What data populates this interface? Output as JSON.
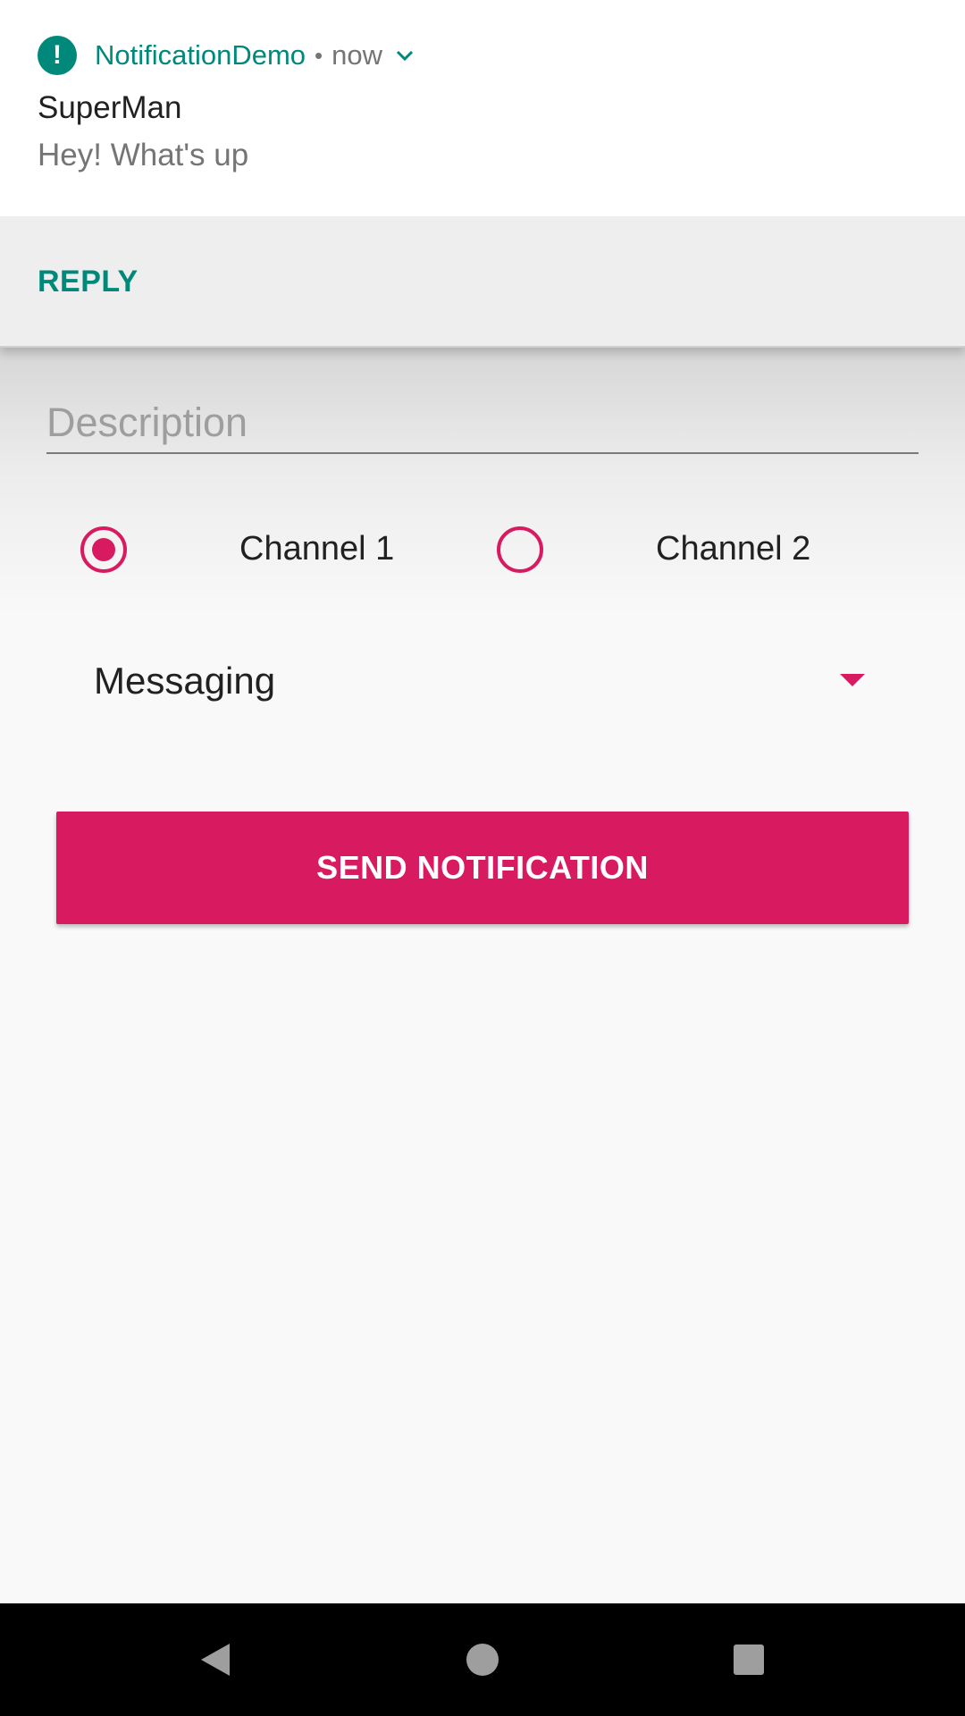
{
  "notification": {
    "app_icon": "alert-icon",
    "app_icon_glyph": "!",
    "app_name": "NotificationDemo",
    "separator": "•",
    "time": "now",
    "expand_icon": "chevron-down-icon",
    "title": "SuperMan",
    "text": "Hey! What's up",
    "action_label": "REPLY"
  },
  "form": {
    "description_placeholder": "Description",
    "description_value": "",
    "channels": [
      {
        "label": "Channel 1",
        "checked": true
      },
      {
        "label": "Channel 2",
        "checked": false
      }
    ],
    "category_selected": "Messaging",
    "send_button_label": "SEND NOTIFICATION"
  },
  "nav": {
    "back_icon": "back-triangle-icon",
    "home_icon": "home-circle-icon",
    "recents_icon": "recents-square-icon"
  },
  "colors": {
    "accent": "#d81b60",
    "notification_accent": "#00897b",
    "background": "#f9f9f9",
    "nav_bar": "#000000"
  }
}
